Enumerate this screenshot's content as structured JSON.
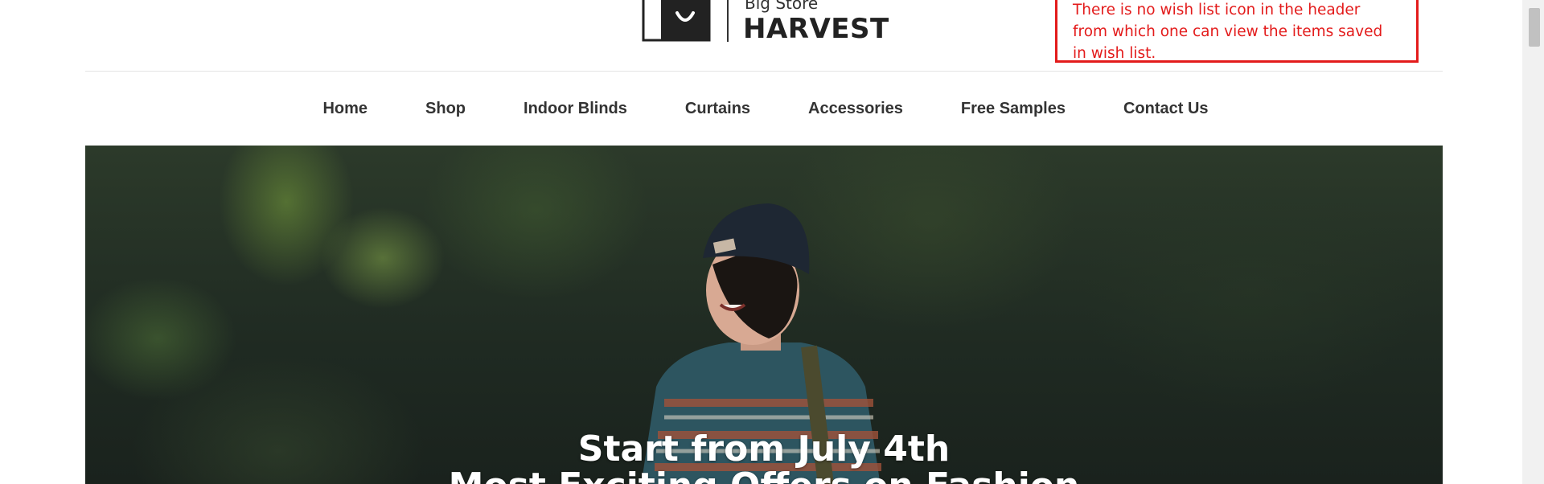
{
  "header": {
    "logo_subtitle": "Big Store",
    "logo_name": "HARVEST"
  },
  "annotation": {
    "line1": "There is no wish list icon in the header",
    "line2": "from which one can view the items saved",
    "line3": "in wish list."
  },
  "nav": {
    "items": [
      "Home",
      "Shop",
      "Indoor Blinds",
      "Curtains",
      "Accessories",
      "Free Samples",
      "Contact Us"
    ]
  },
  "hero": {
    "line1": "Start from July 4th",
    "line2": "Most Exciting Offers on Fashion"
  },
  "colors": {
    "annotation_red": "#e31b1b",
    "nav_text": "#333333",
    "hero_text": "#ffffff"
  },
  "icons": [
    "shopping-bag-icon"
  ]
}
